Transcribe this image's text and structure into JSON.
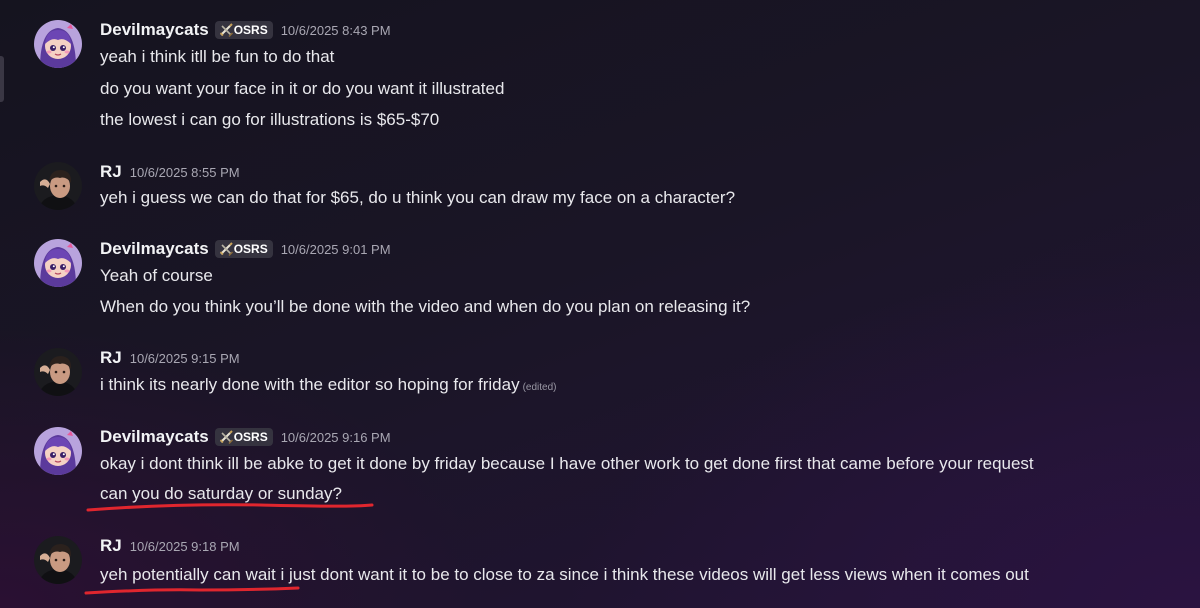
{
  "users": {
    "devil": {
      "name": "Devilmaycats",
      "tag": "OSRS"
    },
    "rj": {
      "name": "RJ"
    }
  },
  "messages": [
    {
      "time": "10/6/2025 8:43 PM",
      "lines": [
        "yeah i think itll be fun to do that",
        "do you want your face in it or do you want it illustrated",
        "the lowest i can go for illustrations is $65-$70"
      ]
    },
    {
      "time": "10/6/2025 8:55 PM",
      "lines": [
        "yeh i guess we can do that for $65, do u think you can draw my face on a character?"
      ]
    },
    {
      "time": "10/6/2025 9:01 PM",
      "lines": [
        "Yeah of course",
        "When do you think you’ll be done with the video and when do you plan on releasing it?"
      ]
    },
    {
      "time": "10/6/2025 9:15 PM",
      "lines": [
        "i think its nearly done with the editor so hoping for friday"
      ],
      "edited_label": "(edited)"
    },
    {
      "time": "10/6/2025 9:16 PM",
      "lines": [
        "okay i dont think ill be abke to get it done by friday because I have other work to get done first that came before your request",
        "can you do saturday or sunday?"
      ]
    },
    {
      "time": "10/6/2025 9:18 PM",
      "lines": [
        "yeh potentially can wait i just dont want it to be to close to za since i think these videos will get less views when it comes out"
      ]
    }
  ],
  "colors": {
    "annotation_underline": "#e0262e",
    "tag_background": "#35333f",
    "username": "#f2f3f5",
    "timestamp": "#a9a7b3"
  },
  "icons": {
    "tag_icon": "crossed-swords-icon",
    "avatar_devil": "anime-girl-avatar",
    "avatar_rj": "user-photo-avatar"
  }
}
